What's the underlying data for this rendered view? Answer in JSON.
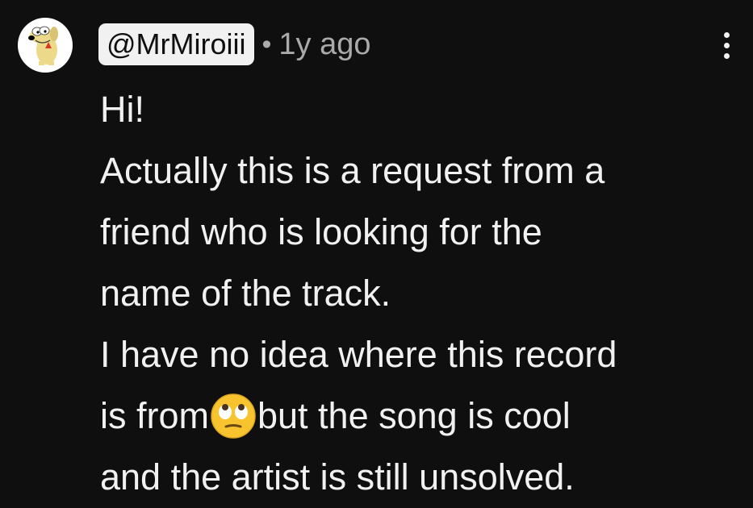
{
  "comment": {
    "author_handle": "@MrMiroiii",
    "separator": "•",
    "timestamp": "1y ago",
    "menu_icon": "more-vert-icon",
    "avatar_icon": "cartoon-dog-avatar",
    "emoji_icon": "face-with-rolling-eyes-emoji",
    "lines": [
      "Hi!",
      "Actually this is a request from a",
      "friend who is looking for the",
      "name of the track.",
      "I have no idea where this record",
      "but the song is cool",
      "and the artist is still unsolved."
    ],
    "line6_prefix": "is from",
    "colors": {
      "background": "#0f0f0f",
      "text": "#f1f1f1",
      "secondary_text": "#aaaaaa",
      "handle_chip_bg": "#f1f1f1"
    }
  }
}
